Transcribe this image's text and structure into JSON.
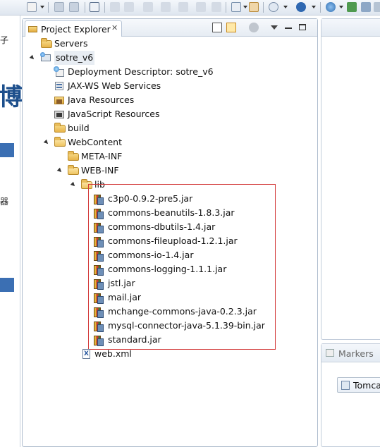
{
  "toolbar": {
    "icons": [
      "new-icon",
      "save-icon",
      "save-all-icon",
      "skip-breakpoints-icon",
      "debug-icon",
      "run-icon",
      "step-icon",
      "search-icon",
      "globe-icon",
      "web-browser-icon",
      "tomcat-icon"
    ]
  },
  "left_strip": {
    "char_top": "子",
    "char_big": "博",
    "char_mid": "器"
  },
  "project_explorer": {
    "tab_title": "Project Explorer",
    "tab_close": "✕",
    "tree": [
      {
        "label": "Servers"
      },
      {
        "label": "sotre_v6"
      },
      {
        "label": "Deployment Descriptor: sotre_v6"
      },
      {
        "label": "JAX-WS Web Services"
      },
      {
        "label": "Java Resources"
      },
      {
        "label": "JavaScript Resources"
      },
      {
        "label": "build"
      },
      {
        "label": "WebContent"
      },
      {
        "label": "META-INF"
      },
      {
        "label": "WEB-INF"
      },
      {
        "label": "lib"
      },
      {
        "label": "c3p0-0.9.2-pre5.jar"
      },
      {
        "label": "commons-beanutils-1.8.3.jar"
      },
      {
        "label": "commons-dbutils-1.4.jar"
      },
      {
        "label": "commons-fileupload-1.2.1.jar"
      },
      {
        "label": "commons-io-1.4.jar"
      },
      {
        "label": "commons-logging-1.1.1.jar"
      },
      {
        "label": "jstl.jar"
      },
      {
        "label": "mail.jar"
      },
      {
        "label": "mchange-commons-java-0.2.3.jar"
      },
      {
        "label": "mysql-connector-java-5.1.39-bin.jar"
      },
      {
        "label": "standard.jar"
      },
      {
        "label": "web.xml"
      }
    ]
  },
  "markers_panel": {
    "title": "Markers",
    "server_label": "Tomca"
  },
  "colors": {
    "highlight_border": "#d33a3a",
    "folder": "#e7b44a",
    "panel_border": "#aebccd"
  }
}
